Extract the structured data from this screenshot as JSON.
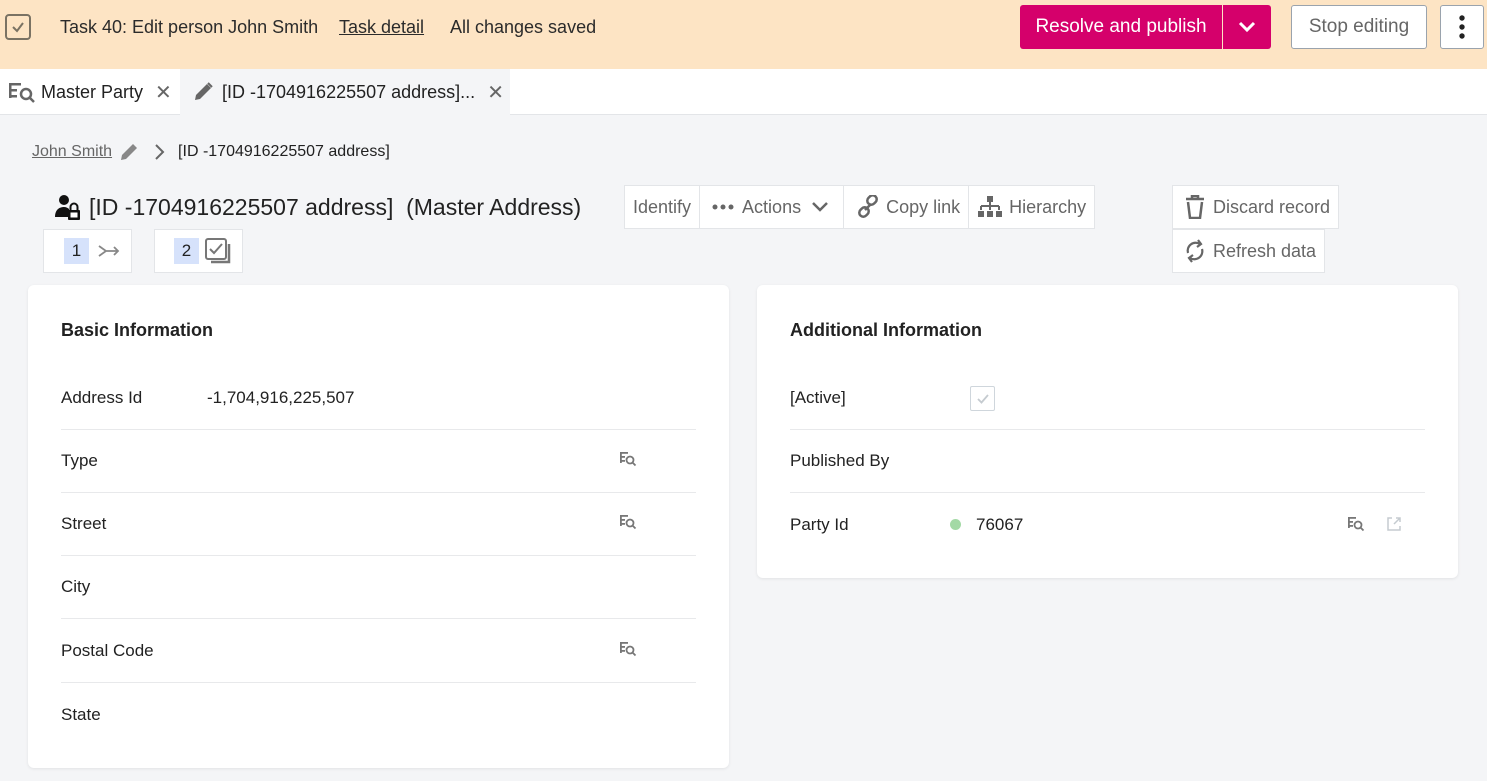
{
  "topbar": {
    "task_title": "Task 40: Edit person John Smith",
    "task_detail_link": "Task detail",
    "save_status": "All changes saved",
    "resolve_button": "Resolve and publish",
    "stop_button": "Stop editing",
    "background_color": "#fde4c4",
    "accent_color": "#d5006b"
  },
  "tabs": [
    {
      "label": "Master Party",
      "icon": "lookup-icon",
      "active": false
    },
    {
      "label": "[ID -1704916225507 address]...",
      "icon": "pencil-icon",
      "active": true
    }
  ],
  "breadcrumb": {
    "parent": "John Smith",
    "current": "[ID -1704916225507 address]"
  },
  "record": {
    "title": "[ID -1704916225507 address]  (Master Address)",
    "badges": [
      {
        "count": "1",
        "icon": "merge-icon"
      },
      {
        "count": "2",
        "icon": "tasks-icon"
      }
    ]
  },
  "actions": {
    "identify": "Identify",
    "actions": "Actions",
    "copy_link": "Copy link",
    "hierarchy": "Hierarchy",
    "discard": "Discard record",
    "refresh": "Refresh data"
  },
  "basic_info": {
    "title": "Basic Information",
    "fields": [
      {
        "label": "Address Id",
        "value": "-1,704,916,225,507",
        "lookup": false
      },
      {
        "label": "Type",
        "value": "",
        "lookup": true
      },
      {
        "label": "Street",
        "value": "",
        "lookup": true
      },
      {
        "label": "City",
        "value": "",
        "lookup": false
      },
      {
        "label": "Postal Code",
        "value": "",
        "lookup": true
      },
      {
        "label": "State",
        "value": "",
        "lookup": false
      }
    ]
  },
  "additional_info": {
    "title": "Additional Information",
    "fields": [
      {
        "label": "[Active]",
        "value": "checked",
        "type": "checkbox"
      },
      {
        "label": "Published By",
        "value": ""
      },
      {
        "label": "Party Id",
        "value": "76067",
        "status_color": "#a3d9a5"
      }
    ]
  }
}
